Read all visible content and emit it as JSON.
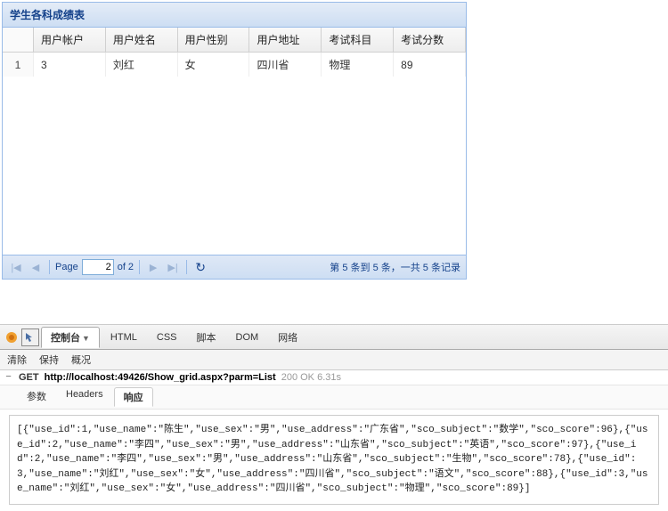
{
  "panel": {
    "title": "学生各科成绩表",
    "columns": [
      "用户帐户",
      "用户姓名",
      "用户性别",
      "用户地址",
      "考试科目",
      "考试分数"
    ],
    "rows": [
      {
        "num": "1",
        "account": "3",
        "name": "刘红",
        "sex": "女",
        "address": "四川省",
        "subject": "物理",
        "score": "89"
      }
    ]
  },
  "paging": {
    "page_label": "Page",
    "page_value": "2",
    "of_text": "of 2",
    "status": "第 5 条到 5 条，一共 5 条记录"
  },
  "devtools": {
    "tabs": [
      "控制台",
      "HTML",
      "CSS",
      "脚本",
      "DOM",
      "网络"
    ],
    "active_tab": "控制台",
    "toolbar": [
      "清除",
      "保持",
      "概况"
    ],
    "request": {
      "method": "GET",
      "url": "http://localhost:49426/Show_grid.aspx?parm=List",
      "status": "200 OK 6.31s"
    },
    "subtabs": [
      "参数",
      "Headers",
      "响应"
    ],
    "active_subtab": "响应",
    "response_body": "[{\"use_id\":1,\"use_name\":\"陈生\",\"use_sex\":\"男\",\"use_address\":\"广东省\",\"sco_subject\":\"数学\",\"sco_score\":96},{\"use_id\":2,\"use_name\":\"李四\",\"use_sex\":\"男\",\"use_address\":\"山东省\",\"sco_subject\":\"英语\",\"sco_score\":97},{\"use_id\":2,\"use_name\":\"李四\",\"use_sex\":\"男\",\"use_address\":\"山东省\",\"sco_subject\":\"生物\",\"sco_score\":78},{\"use_id\":3,\"use_name\":\"刘红\",\"use_sex\":\"女\",\"use_address\":\"四川省\",\"sco_subject\":\"语文\",\"sco_score\":88},{\"use_id\":3,\"use_name\":\"刘红\",\"use_sex\":\"女\",\"use_address\":\"四川省\",\"sco_subject\":\"物理\",\"sco_score\":89}]"
  }
}
